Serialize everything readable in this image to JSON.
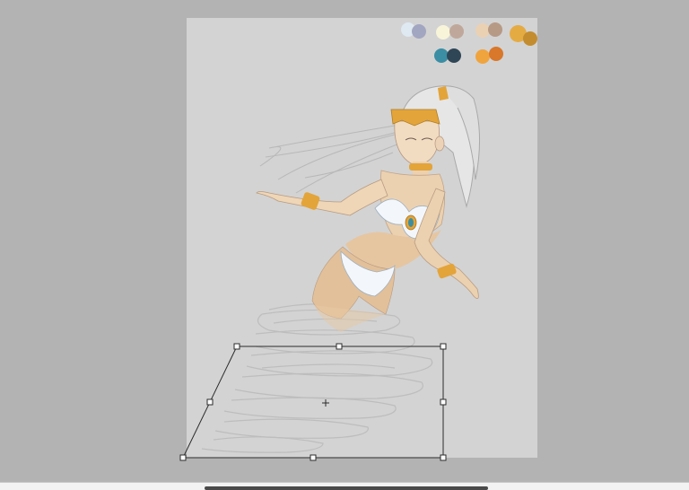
{
  "app": {
    "view": "canvas-transform"
  },
  "palette": {
    "swatches": [
      {
        "name": "ice-white",
        "color": "#dfe9f1"
      },
      {
        "name": "lavender-grey",
        "color": "#a3a6c0"
      },
      {
        "name": "cream",
        "color": "#f8f4d9"
      },
      {
        "name": "taupe",
        "color": "#bfa89b"
      },
      {
        "name": "skin-light",
        "color": "#ead1b4"
      },
      {
        "name": "skin-shadow",
        "color": "#b79a85"
      },
      {
        "name": "gold-light",
        "color": "#e5ab43"
      },
      {
        "name": "gold-dark",
        "color": "#c38c2f"
      },
      {
        "name": "teal",
        "color": "#3b8ea3"
      },
      {
        "name": "navy",
        "color": "#2f4656"
      },
      {
        "name": "orange-light",
        "color": "#f0a43d"
      },
      {
        "name": "orange-dark",
        "color": "#d9772a"
      }
    ]
  },
  "tool": {
    "name": "free-transform",
    "active": true
  },
  "scrollbar": {
    "horizontal": true
  }
}
